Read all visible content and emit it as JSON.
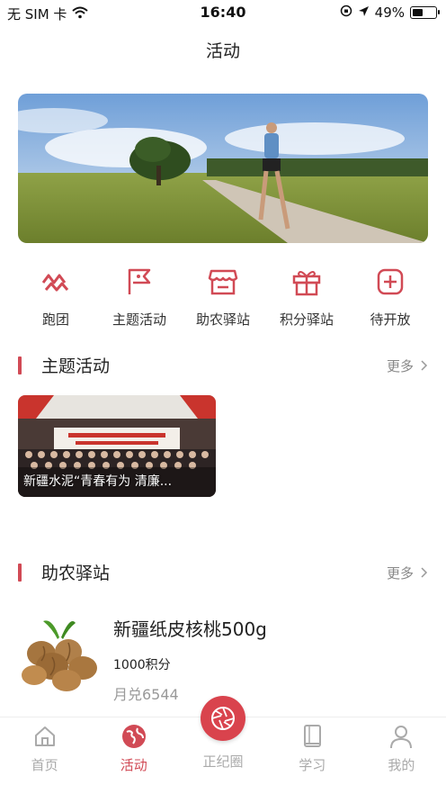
{
  "status_bar": {
    "carrier": "无 SIM 卡",
    "time": "16:40",
    "battery_percent": "49%",
    "battery_level": 0.49
  },
  "nav": {
    "title": "活动"
  },
  "quick_actions": [
    {
      "label": "跑团",
      "icon": "running-group-icon"
    },
    {
      "label": "主题活动",
      "icon": "flag-icon"
    },
    {
      "label": "助农驿站",
      "icon": "store-icon"
    },
    {
      "label": "积分驿站",
      "icon": "gift-icon"
    },
    {
      "label": "待开放",
      "icon": "plus-square-icon"
    }
  ],
  "section_theme": {
    "title": "主题活动",
    "more": "更多"
  },
  "theme_activity": {
    "caption": "新疆水泥“青春有为 清廉..."
  },
  "section_farm": {
    "title": "助农驿站",
    "more": "更多"
  },
  "product": {
    "name": "新疆纸皮核桃500g",
    "points": "1000积分",
    "monthly_sales": "月兑6544"
  },
  "tabs": [
    {
      "label": "首页",
      "icon": "home-icon"
    },
    {
      "label": "活动",
      "icon": "globe-icon"
    },
    {
      "label": "正纪圈",
      "icon": "aperture-icon"
    },
    {
      "label": "学习",
      "icon": "book-icon"
    },
    {
      "label": "我的",
      "icon": "user-icon"
    }
  ],
  "colors": {
    "accent": "#d14a55"
  }
}
